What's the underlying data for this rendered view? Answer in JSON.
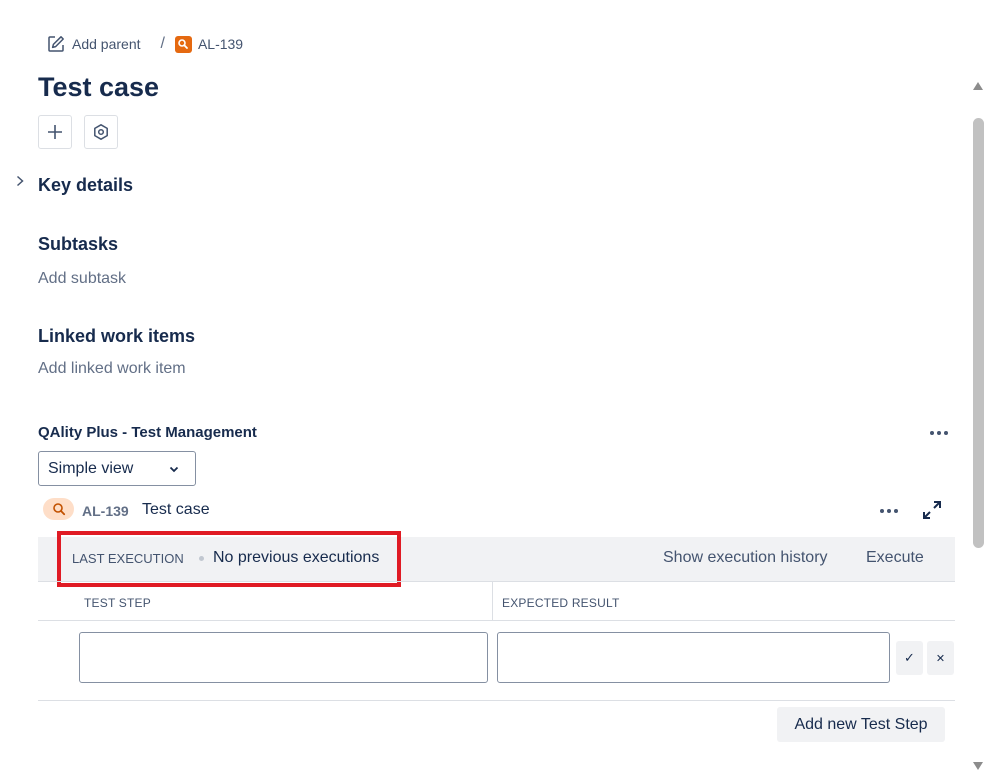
{
  "breadcrumb": {
    "add_parent": "Add parent",
    "separator": "/",
    "issue_key": "AL-139"
  },
  "issue": {
    "title": "Test case"
  },
  "sections": {
    "key_details": "Key details",
    "subtasks": "Subtasks",
    "add_subtask": "Add subtask",
    "linked": "Linked work items",
    "add_linked": "Add linked work item"
  },
  "qality": {
    "title": "QAlity Plus - Test Management",
    "view_select": "Simple view",
    "test_key": "AL-139",
    "test_name": "Test case",
    "last_execution_label": "LAST EXECUTION",
    "last_execution_value": "No previous executions",
    "show_history": "Show execution history",
    "execute": "Execute",
    "col_step": "TEST STEP",
    "col_result": "EXPECTED RESULT",
    "confirm_symbol": "✓",
    "cancel_symbol": "✕",
    "add_step": "Add new Test Step"
  },
  "colors": {
    "highlight": "#e01b24",
    "issue_icon": "#e56910",
    "test_icon_bg": "#fedec8"
  }
}
